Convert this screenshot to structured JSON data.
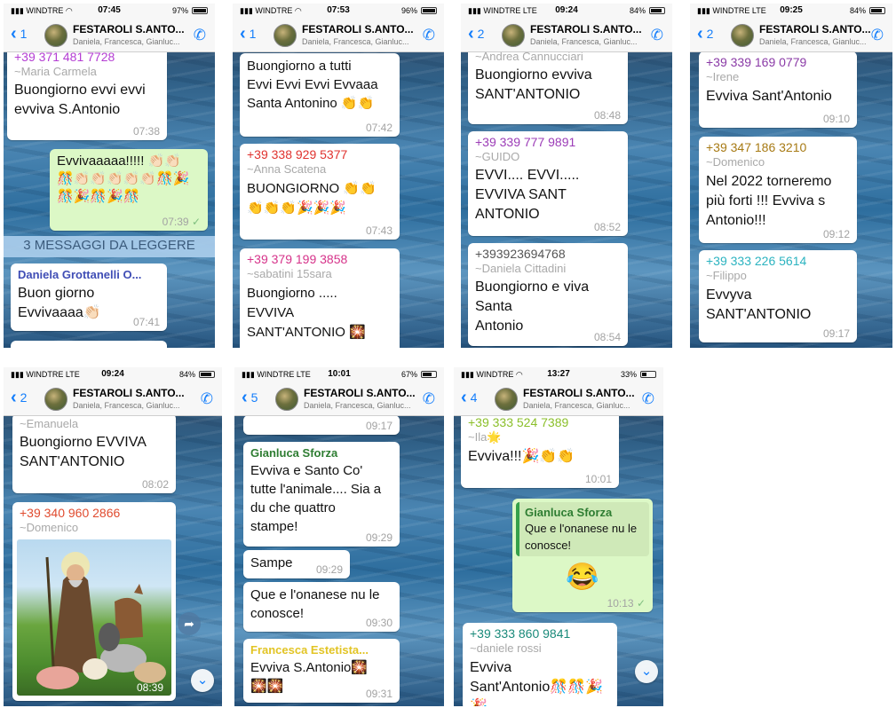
{
  "group": {
    "name": "FESTAROLI S.ANTO...",
    "members": "Daniela, Francesca, Gianluc..."
  },
  "colors": {
    "ios_blue": "#147efb",
    "outgoing_bubble": "#dcf8c6",
    "incoming_bubble": "#ffffff",
    "unread_text": "#3b5b7c"
  },
  "icons": {
    "back": "chevron-left-icon",
    "call": "add-call-icon",
    "scroll_down": "chevron-down-circle-icon",
    "forward": "forward-arrow-icon"
  },
  "screens": [
    {
      "status": {
        "carrier": "WINDTRE",
        "time": "07:45",
        "battery": "97%",
        "battery_level": 0.97
      },
      "back_count": "1",
      "messages": [
        {
          "sender": "+39 371 481 7728",
          "nick": "~Maria Carmela",
          "text": "Buongiorno evvi evvi\nevviva S.Antonio",
          "time": "07:38"
        },
        {
          "text": "Evvivaaaaa!!!!! 👏🏻👏🏻\n🎊👏🏻👏🏻👏🏻👏🏻👏🏻🎊🎉\n🎊🎉🎊🎉🎊",
          "time": "07:39"
        },
        {
          "sender": "Daniela Grottanelli O...",
          "text": "Buon giorno\nEvvivaaaa👏🏻",
          "time": "07:41"
        }
      ],
      "unread_banner": "3 MESSAGGI DA LEGGERE"
    },
    {
      "status": {
        "carrier": "WINDTRE",
        "time": "07:53",
        "battery": "96%",
        "battery_level": 0.96
      },
      "back_count": "1",
      "messages": [
        {
          "text": "Buongiorno  a tutti\nEvvi Evvi Evvi Evvaaa\nSanta Antonino 👏👏",
          "time": "07:42"
        },
        {
          "sender": "+39 338 929 5377",
          "nick": "~Anna Scatena",
          "text": "BUONGIORNO 👏👏\n👏👏👏🎉🎉🎉",
          "time": "07:43"
        },
        {
          "sender": "+39 379 199 3858",
          "nick": "~sabatini 15sara",
          "text": "Buongiorno .....\nEVVIVA\nSANT'ANTONIO 🎇"
        }
      ]
    },
    {
      "status": {
        "carrier": "WINDTRE  LTE",
        "time": "09:24",
        "battery": "84%",
        "battery_level": 0.84
      },
      "back_count": "2",
      "messages": [
        {
          "nick": "~Andrea Cannucciari",
          "text": "Buongiorno evviva\nSANT'ANTONIO",
          "time": "08:48"
        },
        {
          "sender": "+39 339 777 9891",
          "nick": "~GUIDO",
          "text": "EVVI.... EVVI.....\nEVVIVA SANT\nANTONIO",
          "time": "08:52"
        },
        {
          "sender": "+393923694768",
          "nick": "~Daniela Cittadini",
          "text": "Buongiorno e viva\nSanta\nAntonio",
          "time": "08:54"
        }
      ]
    },
    {
      "status": {
        "carrier": "WINDTRE  LTE",
        "time": "09:25",
        "battery": "84%",
        "battery_level": 0.84
      },
      "back_count": "2",
      "messages": [
        {
          "sender": "+39 339 169 0779",
          "nick": "~Irene",
          "text": "Evviva Sant'Antonio",
          "time": "09:10"
        },
        {
          "sender": "+39 347 186 3210",
          "nick": "~Domenico",
          "text": "Nel 2022 torneremo\npiù forti !!! Evviva s\nAntonio!!!",
          "time": "09:12"
        },
        {
          "sender": "+39 333 226 5614",
          "nick": "~Filippo",
          "text": "Evvyva\nSANT'ANTONIO",
          "time": "09:17"
        }
      ]
    },
    {
      "status": {
        "carrier": "WINDTRE  LTE",
        "time": "09:24",
        "battery": "84%",
        "battery_level": 0.84
      },
      "back_count": "2",
      "messages": [
        {
          "nick": "~Emanuela",
          "text": "Buongiorno EVVIVA\nSANT'ANTONIO",
          "time": "08:02"
        },
        {
          "sender": "+39 340 960 2866",
          "nick": "~Domenico",
          "time": "08:39"
        }
      ]
    },
    {
      "status": {
        "carrier": "WINDTRE  LTE",
        "time": "10:01",
        "battery": "67%",
        "battery_level": 0.67
      },
      "back_count": "5",
      "messages": [
        {
          "time": "09:17"
        },
        {
          "sender": "Gianluca Sforza",
          "text": "Evviva e Santo Co'\ntutte l'animale.... Sia a\ndu che quattro\nstampe!",
          "time": "09:29"
        },
        {
          "text": "Sampe",
          "time": "09:29"
        },
        {
          "text": "Que e l'onanese nu le\nconosce!",
          "time": "09:30"
        },
        {
          "sender": "Francesca Estetista...",
          "text": "Evviva S.Antonio🎇\n🎇🎇",
          "time": "09:31"
        }
      ]
    },
    {
      "status": {
        "carrier": "WINDTRE",
        "time": "13:27",
        "battery": "33%",
        "battery_level": 0.33
      },
      "back_count": "4",
      "messages": [
        {
          "sender": "+39 333 524 7389",
          "nick": "~Ila🌟",
          "text": "Evviva!!!🎉👏👏",
          "time": "10:01"
        },
        {
          "quote_sender": "Gianluca Sforza",
          "quote_text": "Que e l'onanese nu le\nconosce!",
          "text": "😂",
          "time": "10:13"
        },
        {
          "sender": "+39 333 860 9841",
          "nick": "~daniele rossi",
          "text": "Evviva\nSant'Antonio🎊🎊🎉\n🎉"
        }
      ]
    }
  ]
}
